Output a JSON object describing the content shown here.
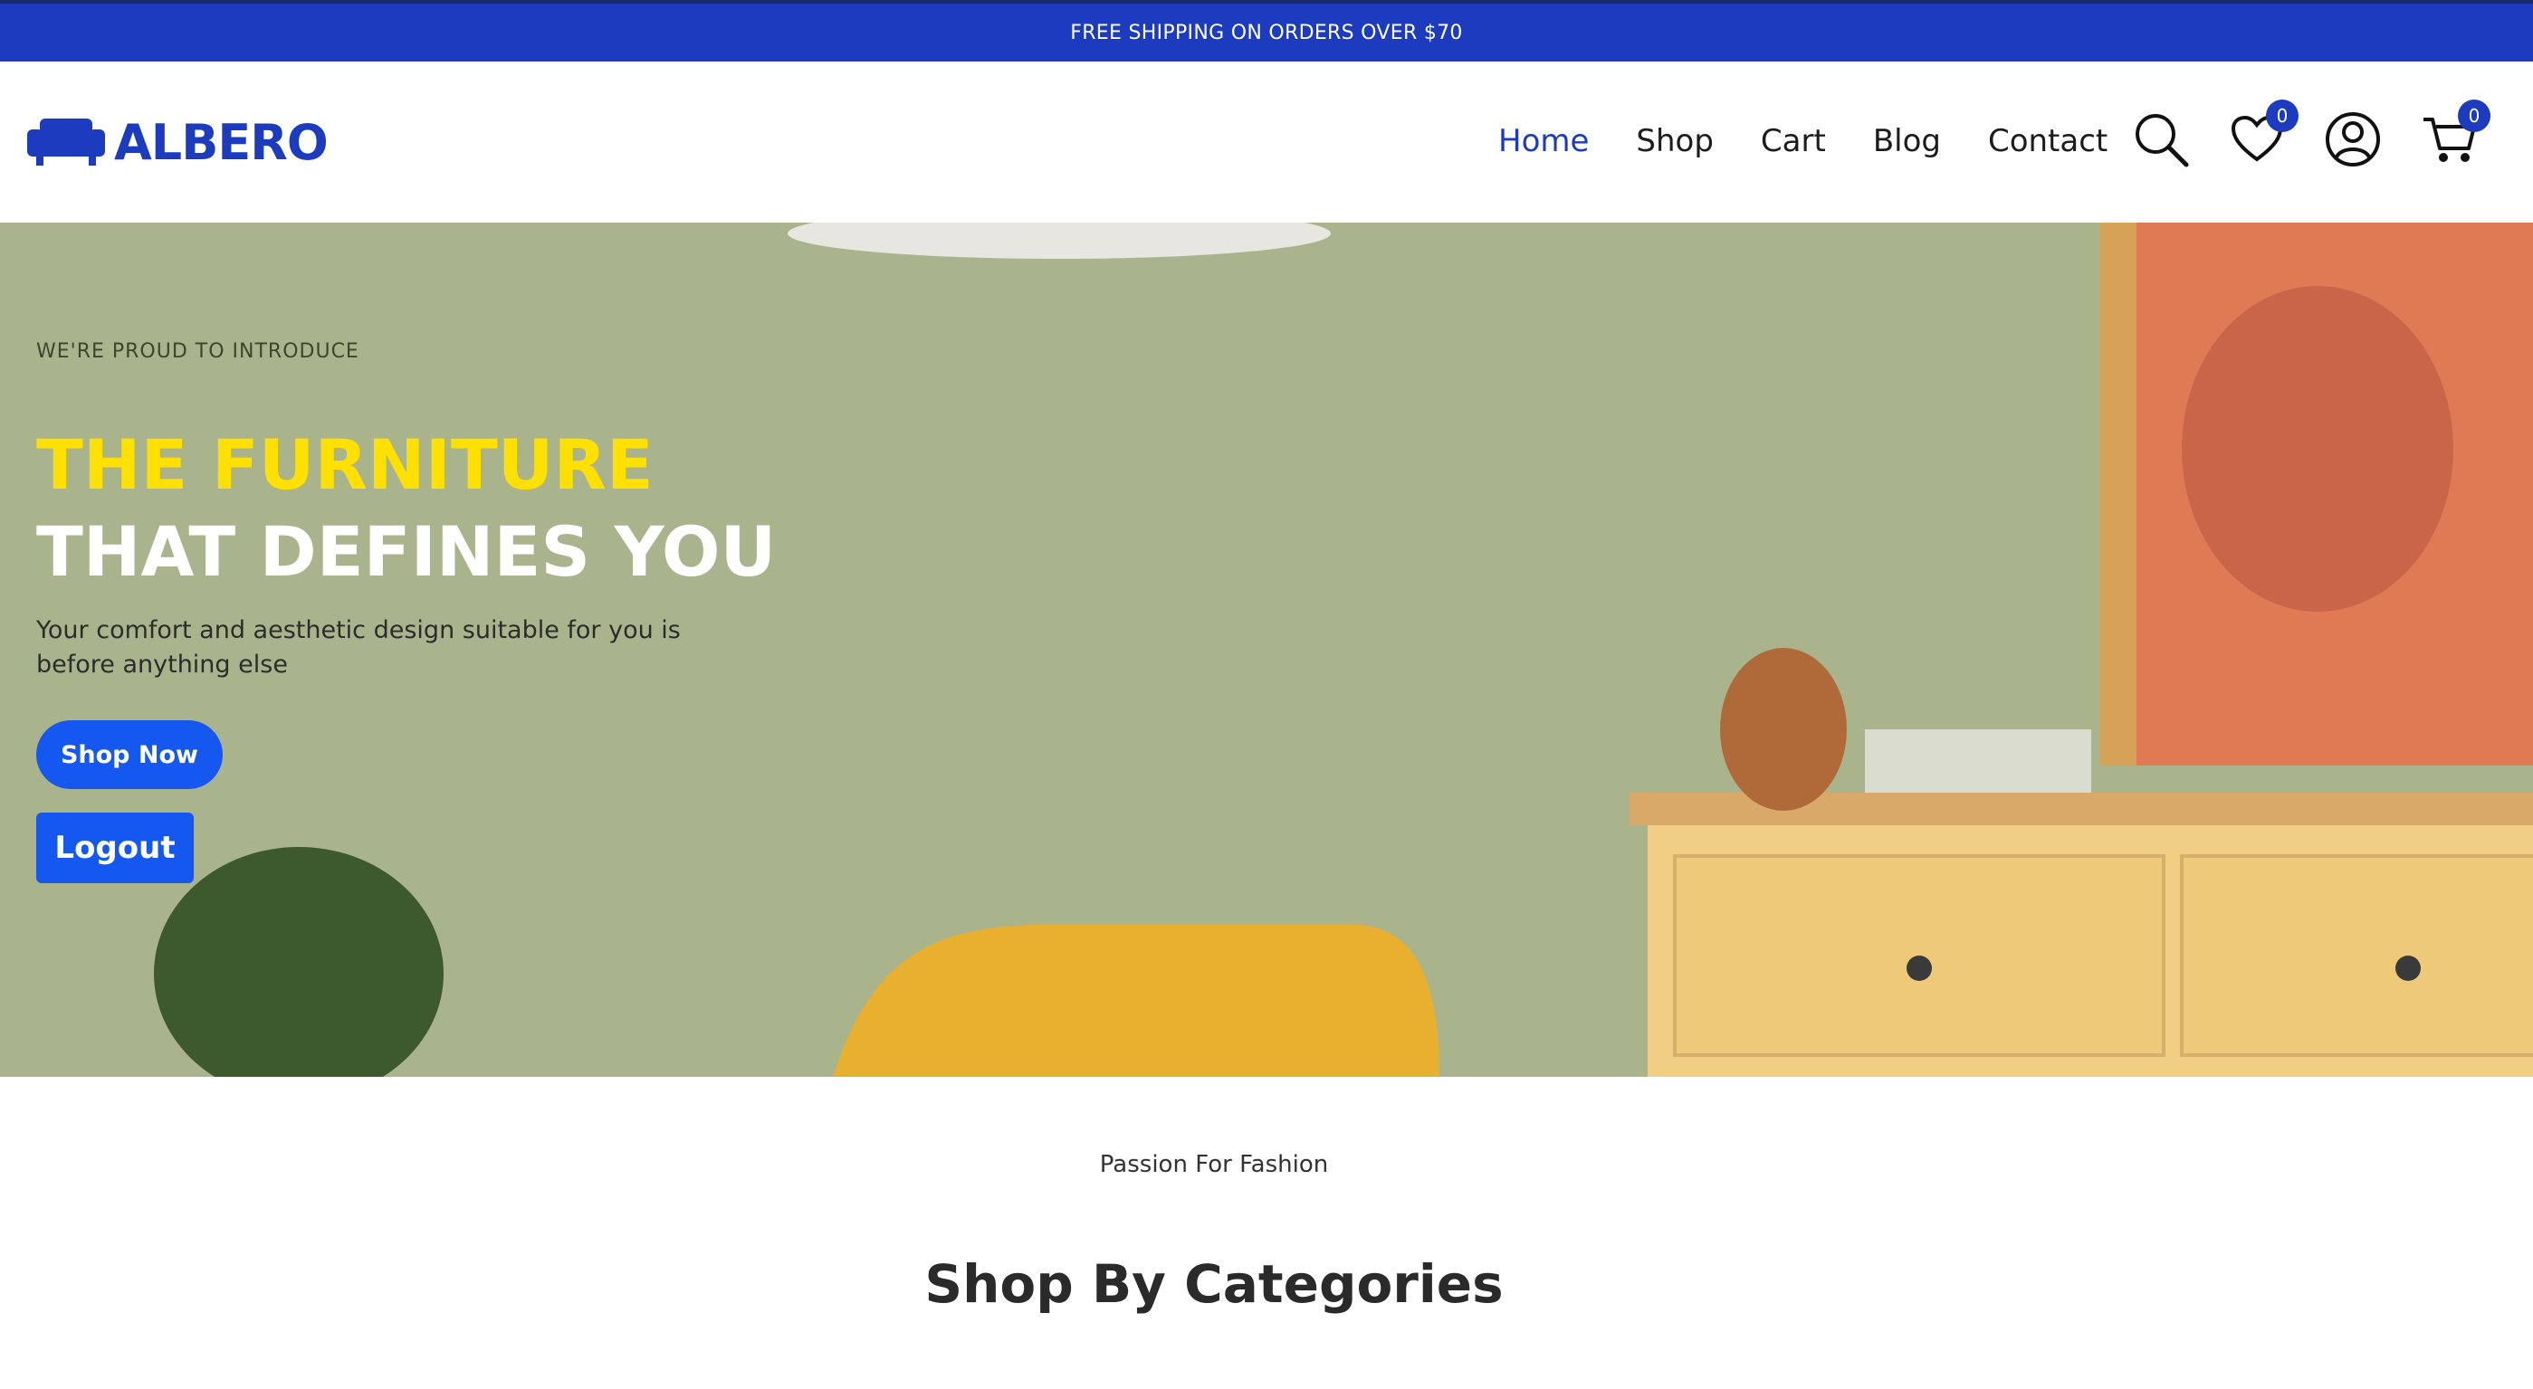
{
  "announcement": {
    "text": "FREE SHIPPING ON ORDERS OVER $70"
  },
  "brand": {
    "name": "ALBERO",
    "color": "#1c3bbf"
  },
  "nav": {
    "items": [
      {
        "label": "Home",
        "active": true
      },
      {
        "label": "Shop",
        "active": false
      },
      {
        "label": "Cart",
        "active": false
      },
      {
        "label": "Blog",
        "active": false
      },
      {
        "label": "Contact",
        "active": false
      }
    ]
  },
  "header_icons": {
    "search": "search-icon",
    "wishlist": {
      "icon": "heart-icon",
      "count": "0"
    },
    "account": "user-icon",
    "cart": {
      "icon": "cart-icon",
      "count": "0"
    }
  },
  "hero": {
    "eyebrow": "WE'RE PROUD TO INTRODUCE",
    "title_line1": "THE FURNITURE",
    "title_line2": "THAT DEFINES YOU",
    "description": "Your comfort and aesthetic design suitable for you is before anything else",
    "shop_button": "Shop Now",
    "logout_button": "Logout"
  },
  "categories": {
    "subtitle": "Passion For Fashion",
    "title": "Shop By Categories"
  },
  "colors": {
    "accent": "#1c3bbf",
    "button": "#1558f0",
    "highlight": "#ffe000"
  }
}
